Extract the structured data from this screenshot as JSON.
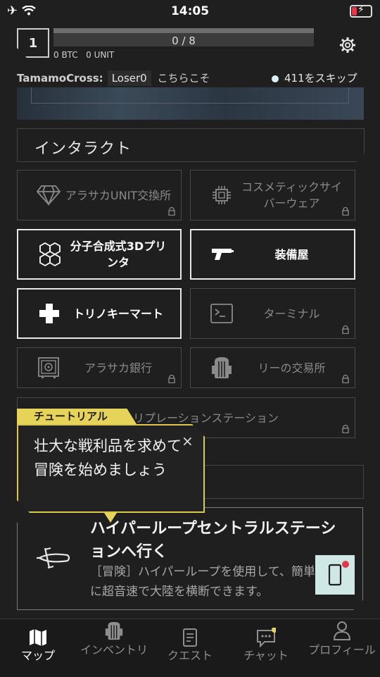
{
  "status_bar": {
    "time": "14:05"
  },
  "player": {
    "level": "1",
    "xp": "0 / 8",
    "currency": "0 BTC   0 UNIT"
  },
  "chat_ticker": {
    "name": "TamamoCross:",
    "message": "Loser0",
    "suffix": "こちらこそ"
  },
  "skip": {
    "label": "411をスキップ"
  },
  "section": {
    "title": "インタラクト"
  },
  "tiles": [
    {
      "label": "アラサカUNIT交換所",
      "icon": "diamond-icon",
      "locked": true
    },
    {
      "label": "コスメティックサイバーウェア",
      "icon": "chip-icon",
      "locked": true
    },
    {
      "label": "分子合成式3Dプリンタ",
      "icon": "hexagon-cluster-icon",
      "locked": false
    },
    {
      "label": "装備屋",
      "icon": "gun-icon",
      "locked": false
    },
    {
      "label": "トリノキーマート",
      "icon": "plus-icon",
      "locked": false
    },
    {
      "label": "ターミナル",
      "icon": "terminal-icon",
      "locked": true
    },
    {
      "label": "アラサカ銀行",
      "icon": "safe-icon",
      "locked": true
    },
    {
      "label": "リーの交易所",
      "icon": "backpack-icon",
      "locked": true
    },
    {
      "label": "リプレーションステーション",
      "icon": "",
      "locked": true
    }
  ],
  "tutorial": {
    "tag": "チュートリアル",
    "text": "壮大な戦利品を求めて冒険を始めましょう",
    "close": "×"
  },
  "travel": {
    "title": "ハイパーループセントラルステーションへ行く",
    "description": "［冒険］ハイパーループを使用して、簡単に超音速で大陸を横断できます。",
    "icon": "hyperloop-icon"
  },
  "nav": [
    {
      "label": "マップ",
      "icon": "map-icon",
      "active": true
    },
    {
      "label": "インベントリ",
      "icon": "backpack-icon",
      "active": false
    },
    {
      "label": "クエスト",
      "icon": "document-icon",
      "active": false
    },
    {
      "label": "チャット",
      "icon": "chat-icon",
      "active": false
    },
    {
      "label": "プロフィール",
      "icon": "person-icon",
      "active": false
    }
  ],
  "colors": {
    "accent": "#e6d35a",
    "notification": "#e0394b",
    "skip_dot": "#d8f2f5"
  }
}
